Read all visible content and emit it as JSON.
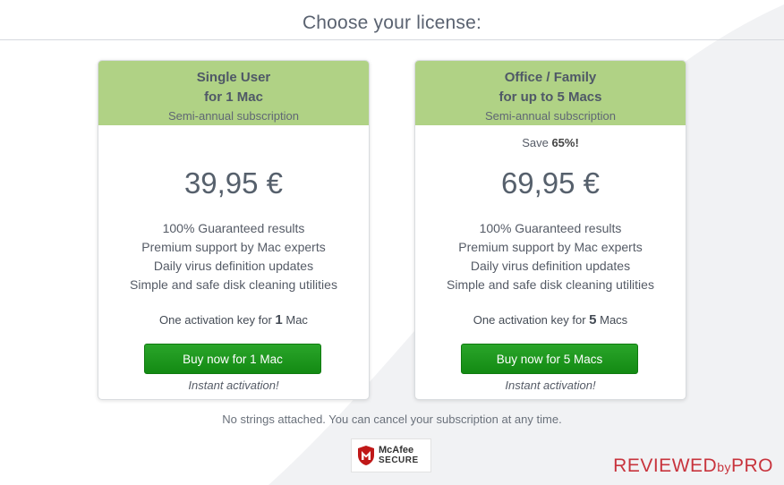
{
  "title": "Choose your license:",
  "plans": [
    {
      "name_line1": "Single User",
      "name_line2": "for 1 Mac",
      "period": "Semi-annual subscription",
      "save_prefix": "",
      "save_value": "",
      "price": "39,95 €",
      "features": [
        "100% Guaranteed results",
        "Premium support by Mac experts",
        "Daily virus definition updates",
        "Simple and safe disk cleaning utilities"
      ],
      "activation_prefix": "One activation key for",
      "activation_count": "1",
      "activation_unit": "Mac",
      "button_label": "Buy now for 1 Mac",
      "instant_label": "Instant activation!"
    },
    {
      "name_line1": "Office / Family",
      "name_line2": "for up to 5 Macs",
      "period": "Semi-annual subscription",
      "save_prefix": "Save",
      "save_value": "65%!",
      "price": "69,95 €",
      "features": [
        "100% Guaranteed results",
        "Premium support by Mac experts",
        "Daily virus definition updates",
        "Simple and safe disk cleaning utilities"
      ],
      "activation_prefix": "One activation key for",
      "activation_count": "5",
      "activation_unit": "Macs",
      "button_label": "Buy now for 5 Macs",
      "instant_label": "Instant activation!"
    }
  ],
  "footer_note": "No strings attached. You can cancel your subscription at any time.",
  "badge": {
    "line1": "McAfee",
    "line2": "SECURE",
    "icon": "mcafee-shield-icon"
  },
  "watermark": {
    "main": "REVIEWED",
    "by": "by",
    "tail": "PRO"
  },
  "colors": {
    "card_header": "#b0d285",
    "button": "#1a961a",
    "watermark": "#c8343d"
  }
}
